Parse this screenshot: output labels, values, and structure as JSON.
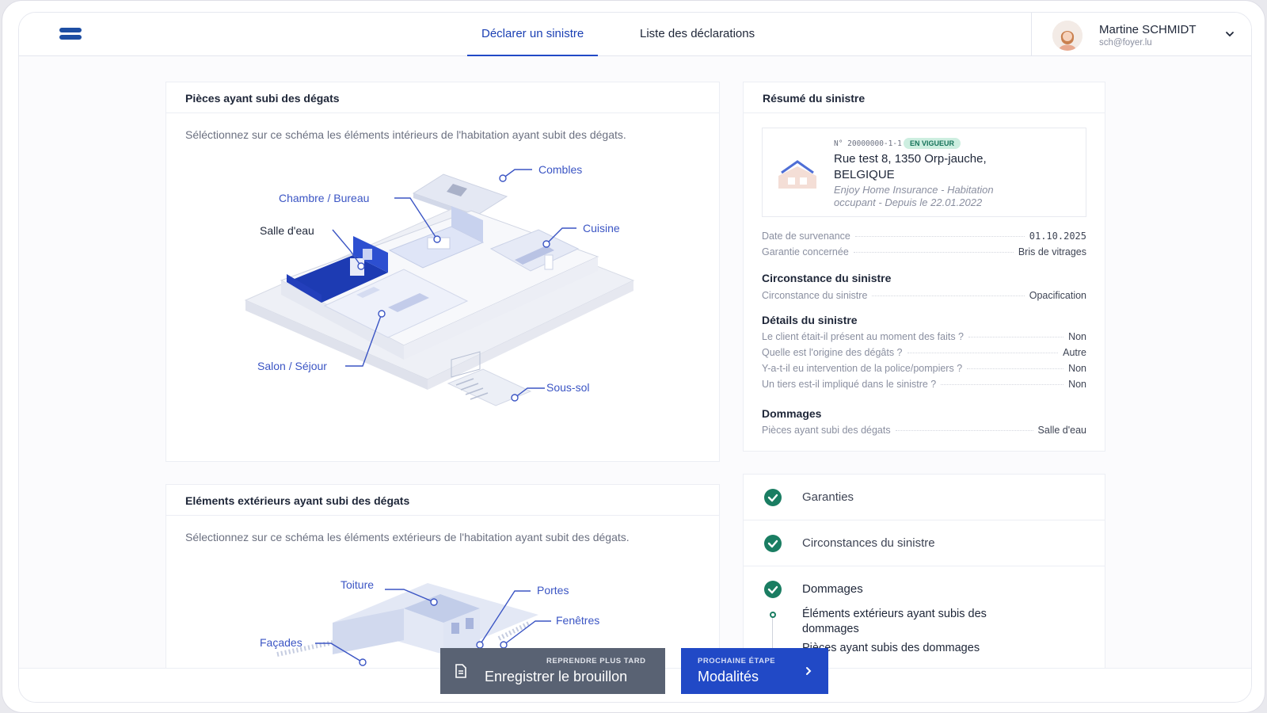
{
  "header": {
    "tabs": [
      {
        "label": "Déclarer un sinistre",
        "active": true
      },
      {
        "label": "Liste des déclarations",
        "active": false
      }
    ],
    "user": {
      "name": "Martine SCHMIDT",
      "email": "sch@foyer.lu"
    }
  },
  "interior": {
    "title": "Pièces ayant subi des dégats",
    "description": "Séléctionnez sur ce schéma les éléments intérieurs de l'habitation ayant subit des dégats.",
    "rooms": {
      "combles": "Combles",
      "chambre": "Chambre / Bureau",
      "salle_eau": "Salle d'eau",
      "cuisine": "Cuisine",
      "salon": "Salon / Séjour",
      "sous_sol": "Sous-sol"
    }
  },
  "exterior": {
    "title": "Eléments extérieurs ayant subi des dégats",
    "description": "Sélectionnez sur ce schéma les éléments extérieurs de l'habitation ayant subit des dégats.",
    "elements": {
      "toiture": "Toiture",
      "portes": "Portes",
      "fenetres": "Fenêtres",
      "facades": "Façades"
    }
  },
  "summary": {
    "title": "Résumé du sinistre",
    "policy": {
      "number": "N° 20000000-1-1",
      "status": "EN VIGUEUR",
      "address_line1": "Rue test 8, 1350 Orp-jauche,",
      "address_line2": "BELGIQUE",
      "product_line1": "Enjoy Home Insurance - Habitation",
      "product_line2": "occupant - Depuis le 22.01.2022"
    },
    "date_label": "Date de survenance",
    "date_value": "01.10.2025",
    "garantie_label": "Garantie concernée",
    "garantie_value": "Bris de vitrages",
    "circ_title": "Circonstance du sinistre",
    "circ_label": "Circonstance du sinistre",
    "circ_value": "Opacification",
    "details_title": "Détails du sinistre",
    "details": [
      {
        "label": "Le client était-il présent au moment des faits ?",
        "value": "Non"
      },
      {
        "label": "Quelle est l'origine des dégâts ?",
        "value": "Autre"
      },
      {
        "label": "Y-a-t-il eu intervention de la police/pompiers ?",
        "value": "Non"
      },
      {
        "label": "Un tiers est-il impliqué dans le sinistre ?",
        "value": "Non"
      }
    ],
    "dommages_title": "Dommages",
    "dommages_label": "Pièces ayant subi des dégats",
    "dommages_value": "Salle d'eau"
  },
  "steps": {
    "items": [
      "Garanties",
      "Circonstances du sinistre",
      "Dommages"
    ],
    "sub_1": "Éléments extérieurs ayant subis des",
    "sub_1b": "dommages",
    "sub_2": "Pièces ayant subis des dommages"
  },
  "footer": {
    "draft_small": "REPRENDRE PLUS TARD",
    "draft_big": "Enregistrer le brouillon",
    "next_small": "PROCHAINE ÉTAPE",
    "next_big": "Modalités"
  },
  "colors": {
    "primary": "#2149c6",
    "success": "#1a7d62",
    "draft_button": "#596273",
    "selected_room": "#1d3bb3"
  }
}
